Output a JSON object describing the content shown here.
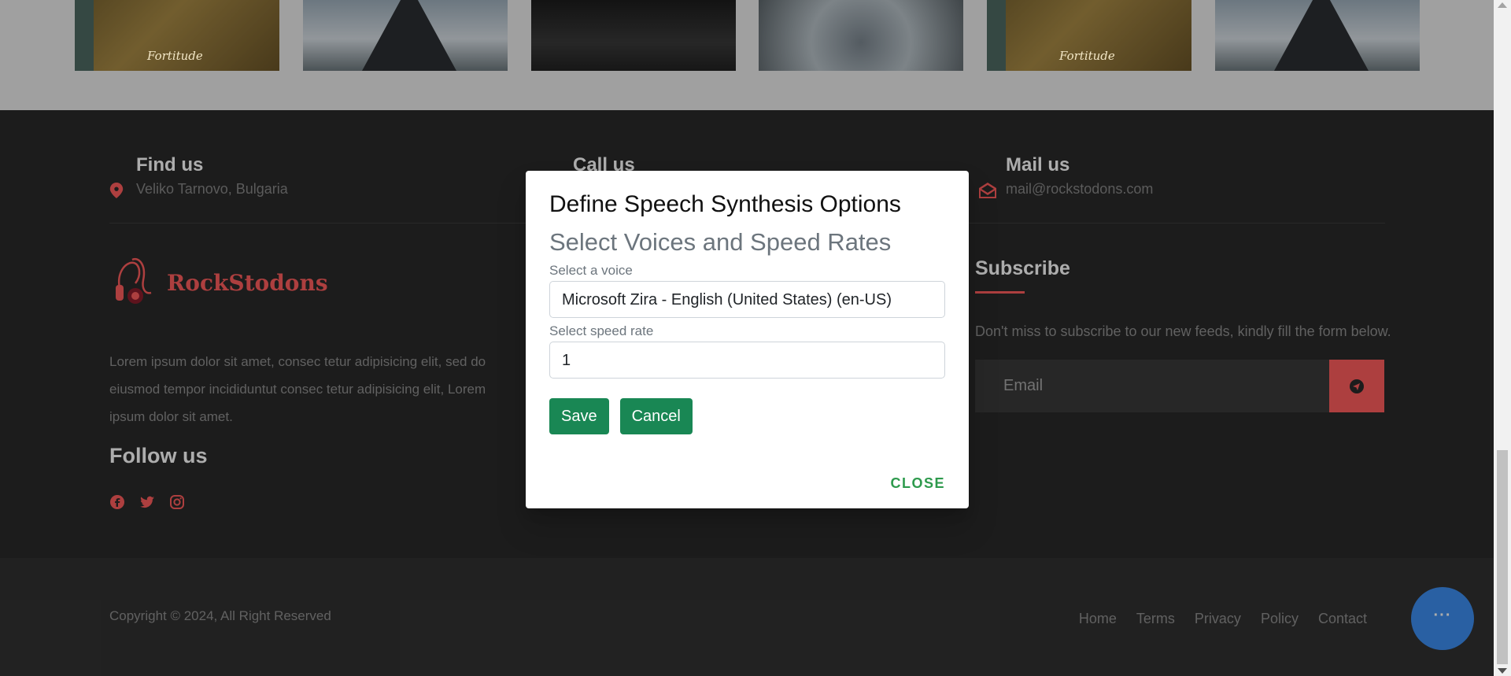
{
  "gallery": {
    "caption": "Fortitude"
  },
  "footer": {
    "find_us": {
      "title": "Find us",
      "value": "Veliko Tarnovo, Bulgaria"
    },
    "call_us": {
      "title": "Call us"
    },
    "mail_us": {
      "title": "Mail us",
      "value": "mail@rockstodons.com"
    },
    "logo_text": "RockStodons",
    "about": "Lorem ipsum dolor sit amet, consec tetur adipisicing elit, sed do eiusmod tempor incididuntut consec tetur adipisicing elit, Lorem ipsum dolor sit amet.",
    "follow_title": "Follow us",
    "social": [
      "facebook-icon",
      "twitter-icon",
      "instagram-icon"
    ],
    "subscribe": {
      "title": "Subscribe",
      "text": "Don't miss to subscribe to our new feeds, kindly fill the form below.",
      "email_placeholder": "Email"
    },
    "copyright": "Copyright © 2024, All Right Reserved",
    "links": [
      "Home",
      "Terms",
      "Privacy",
      "Policy",
      "Contact"
    ],
    "accent_color": "#ff5e5e"
  },
  "modal": {
    "title": "Define Speech Synthesis Options",
    "subtitle": "Select Voices and Speed Rates",
    "voice_label": "Select a voice",
    "voice_value": "Microsoft Zira - English (United States) (en-US)",
    "speed_label": "Select speed rate",
    "speed_value": "1",
    "save_label": "Save",
    "cancel_label": "Cancel",
    "close_label": "CLOSE",
    "button_color": "#198754"
  },
  "chat": {
    "dots": "···",
    "color": "#3d8ef0"
  }
}
